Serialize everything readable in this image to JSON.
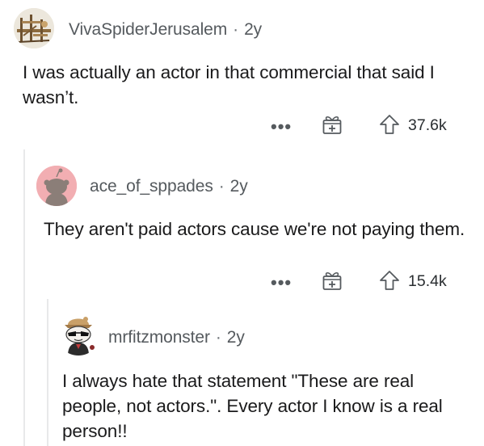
{
  "comments": [
    {
      "username": "VivaSpiderJerusalem",
      "age": "2y",
      "separator": "·",
      "text": "I was actually an actor in that commercial that said I wasn’t.",
      "more_label": "•••",
      "award_icon": "gift-icon",
      "upvote_icon": "upvote-arrow-icon",
      "score": "37.6k"
    },
    {
      "username": "ace_of_sppades",
      "age": "2y",
      "separator": "·",
      "text": "They aren't paid actors cause we're not paying them.",
      "more_label": "•••",
      "award_icon": "gift-icon",
      "upvote_icon": "upvote-arrow-icon",
      "score": "15.4k"
    },
    {
      "username": "mrfitzmonster",
      "age": "2y",
      "separator": "·",
      "text": "I always hate that statement \"These are real people, not actors.\".  Every actor I know is a real person!!"
    }
  ]
}
